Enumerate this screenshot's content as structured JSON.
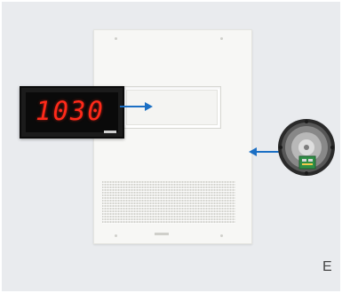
{
  "clock": {
    "time": "1030"
  },
  "figure": {
    "label": "E"
  },
  "colors": {
    "arrow": "#1b6fc4",
    "clock_digits": "#ff2a1a",
    "background": "#e9ebee"
  },
  "icons": {
    "clock": "digital-clock-icon",
    "speaker": "speaker-icon",
    "arrow": "arrow-icon"
  }
}
